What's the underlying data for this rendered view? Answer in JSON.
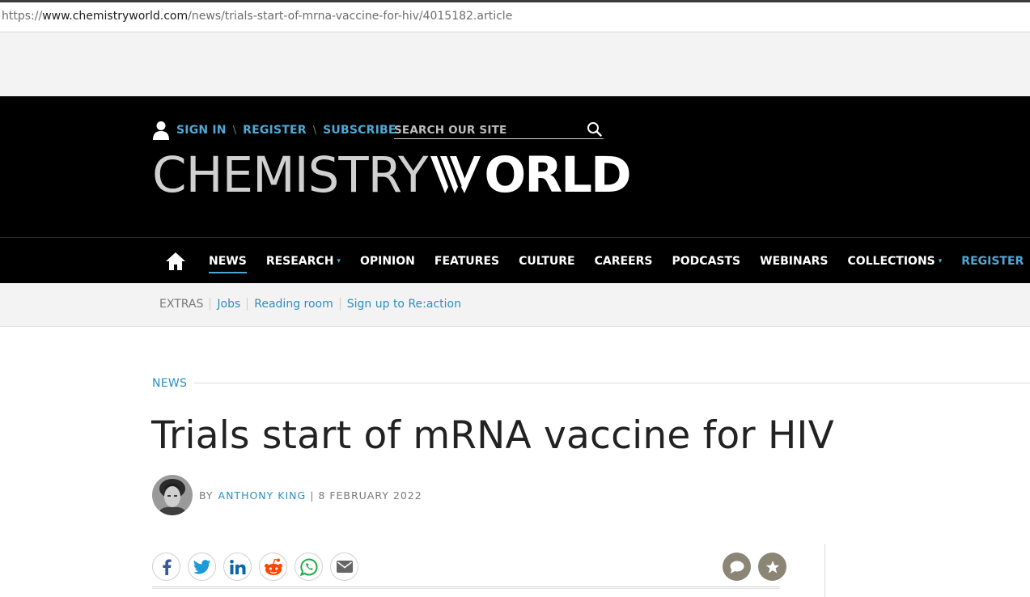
{
  "browser": {
    "url_scheme": "https://",
    "url_host": "www.chemistryworld.com",
    "url_path": "/news/trials-start-of-mrna-vaccine-for-hiv/4015182.article"
  },
  "account": {
    "icon": "user-icon",
    "sign_in": "SIGN IN",
    "register": "REGISTER",
    "subscribe": "SUBSCRIBE",
    "separator": "\\"
  },
  "search": {
    "placeholder": "SEARCH OUR SITE",
    "icon": "search-icon"
  },
  "logo": {
    "part1": "CHEMISTRY",
    "part2": "ORLD"
  },
  "nav": {
    "home_icon": "home-icon",
    "items": [
      {
        "label": "NEWS",
        "active": true
      },
      {
        "label": "RESEARCH",
        "dropdown": true
      },
      {
        "label": "OPINION"
      },
      {
        "label": "FEATURES"
      },
      {
        "label": "CULTURE"
      },
      {
        "label": "CAREERS"
      },
      {
        "label": "PODCASTS"
      },
      {
        "label": "WEBINARS"
      },
      {
        "label": "COLLECTIONS",
        "dropdown": true
      },
      {
        "label": "REGISTER",
        "highlight": true
      }
    ],
    "caret": "▾"
  },
  "extras": {
    "label": "EXTRAS",
    "links": [
      "Jobs",
      "Reading room",
      "Sign up to Re:action"
    ]
  },
  "article": {
    "section": "NEWS",
    "title": "Trials start of mRNA vaccine for HIV",
    "byline_prefix": "BY",
    "author": "ANTHONY KING",
    "separator": "|",
    "date": "8 FEBRUARY 2022"
  },
  "share": {
    "icons": [
      "facebook-icon",
      "twitter-icon",
      "linkedin-icon",
      "reddit-icon",
      "whatsapp-icon",
      "email-icon"
    ]
  },
  "actions": {
    "icons": [
      "comment-icon",
      "star-icon"
    ]
  },
  "colors": {
    "accent": "#4fa9d6",
    "link": "#2b8fc4",
    "masthead_bg": "#000000",
    "action_button": "#8b8575"
  }
}
